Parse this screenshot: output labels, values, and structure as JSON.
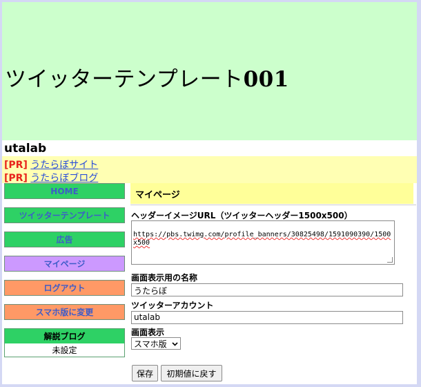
{
  "banner": {
    "title_text": "ツイッターテンプレート",
    "title_number": "001",
    "color": "#ccffcc"
  },
  "user": {
    "name": "utalab"
  },
  "pr": {
    "items": [
      {
        "tag": "[PR]",
        "link": "うたらぼサイト"
      },
      {
        "tag": "[PR]",
        "link": "うたらぼブログ"
      }
    ]
  },
  "sidebar": {
    "items": [
      {
        "label": "HOME",
        "color": "#2ed165"
      },
      {
        "label": "ツイッターテンプレート",
        "color": "#2ed165"
      },
      {
        "label": "広告",
        "color": "#2ed165"
      },
      {
        "label": "マイページ",
        "color": "#cc99ff"
      },
      {
        "label": "ログアウト",
        "color": "#ff9966"
      },
      {
        "label": "スマホ版に変更",
        "color": "#ff9966"
      }
    ],
    "blog": {
      "title": "解説ブログ",
      "value": "未設定"
    }
  },
  "main": {
    "section_title": "マイページ",
    "header_image": {
      "label": "ヘッダーイメージURL（ツイッターヘッダー1500x500）",
      "value": "https://pbs.twimg.com/profile_banners/30825498/1591090390/1500x500"
    },
    "display_name": {
      "label": "画面表示用の名称",
      "value": "うたらぼ"
    },
    "twitter_account": {
      "label": "ツイッターアカウント",
      "value": "utalab"
    },
    "display_mode": {
      "label": "画面表示",
      "selected": "スマホ版",
      "icon": "chevron-down-icon"
    },
    "buttons": {
      "save": "保存",
      "reset": "初期値に戻す"
    }
  }
}
